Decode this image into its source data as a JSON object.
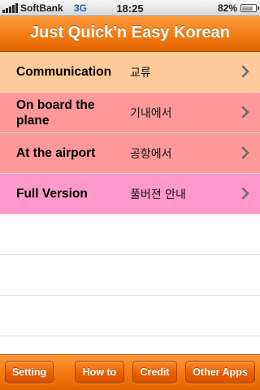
{
  "status_bar": {
    "carrier": "SoftBank",
    "network": "3G",
    "time": "18:25",
    "battery_percent_label": "82%",
    "battery_level": 0.82
  },
  "nav": {
    "title": "Just Quick'n Easy Korean"
  },
  "menu": [
    {
      "label": "Communication",
      "korean": "교류",
      "color": "#ffcc99"
    },
    {
      "label": "On board the plane",
      "korean": "기내에서",
      "color": "#ff9999"
    },
    {
      "label": "At the airport",
      "korean": "공항에서",
      "color": "#ff9999"
    },
    {
      "label": "Full Version",
      "korean": "풀버젼 안내",
      "color": "#ff99cc"
    }
  ],
  "toolbar": {
    "setting_label": "Setting",
    "howto_label": "How to",
    "credit_label": "Credit",
    "otherapps_label": "Other Apps"
  },
  "colors": {
    "accent_orange": "#f47d16",
    "chevron": "#6b6b6b"
  },
  "icons": {
    "row_disclosure": "chevron-right-icon",
    "signal": "signal-bars-icon",
    "battery": "battery-icon"
  }
}
